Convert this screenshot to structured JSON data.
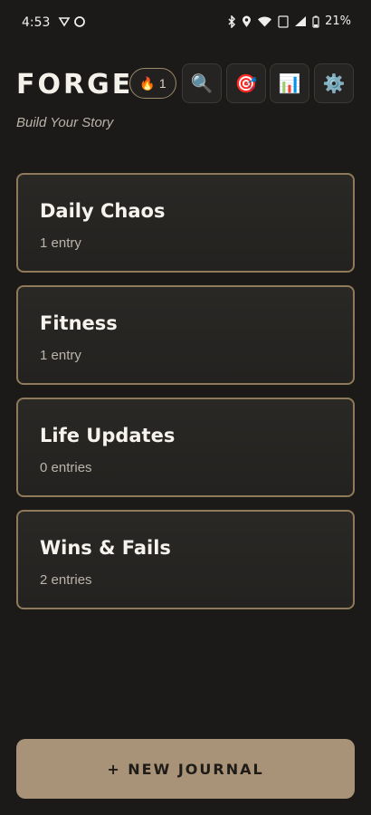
{
  "status": {
    "time": "4:53",
    "battery": "21%"
  },
  "header": {
    "brand": "FORGE",
    "streak_count": "1",
    "streak_icon": "🔥",
    "tagline": "Build Your Story",
    "buttons": [
      {
        "icon": "search-icon",
        "glyph": "🔍"
      },
      {
        "icon": "target-icon",
        "glyph": "🎯"
      },
      {
        "icon": "chart-icon",
        "glyph": "📊"
      },
      {
        "icon": "settings-icon",
        "glyph": "⚙️"
      }
    ]
  },
  "journals": [
    {
      "title": "Daily Chaos",
      "count": "1 entry"
    },
    {
      "title": "Fitness",
      "count": "1 entry"
    },
    {
      "title": "Life Updates",
      "count": "0 entries"
    },
    {
      "title": "Wins & Fails",
      "count": "2 entries"
    }
  ],
  "new_journal_label": "+ NEW JOURNAL",
  "colors": {
    "background": "#1b1a18",
    "card_border": "#8e7a58",
    "accent_button": "#a89278"
  }
}
